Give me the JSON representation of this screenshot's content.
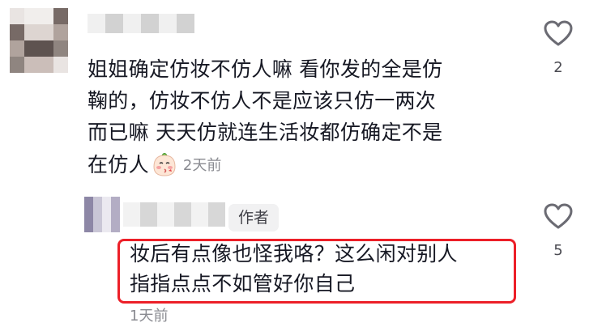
{
  "comment": {
    "text_lines": [
      "姐姐确定仿妆不仿人嘛 看你发的全是仿",
      "鞠的，仿妆不仿人不是应该只仿一两次",
      "而已嘛 天天仿就连生活妆都仿确定不是",
      "在仿人"
    ],
    "emoji": "sticker-blowing-kiss",
    "time": "2天前",
    "like_count": "2"
  },
  "reply": {
    "badge": "作者",
    "text_lines": [
      "妆后有点像也怪我咯？这么闲对别人",
      "指指点点不如管好你自己"
    ],
    "time": "1天前",
    "like_count": "5",
    "highlight_color": "#ec1f28"
  },
  "colors": {
    "text": "#161823",
    "secondary_text": "#8a8b91",
    "badge_bg": "#f1f1f2"
  }
}
